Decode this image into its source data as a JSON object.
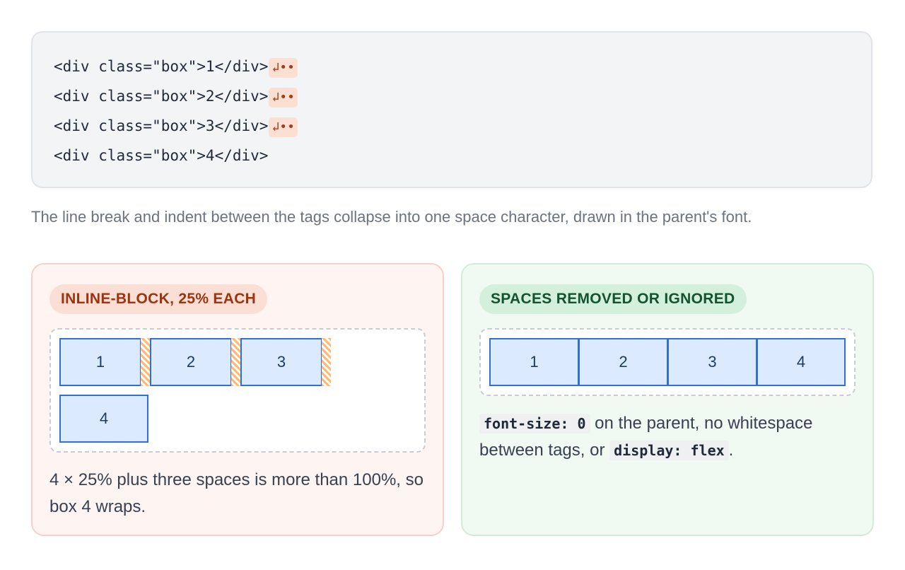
{
  "code": {
    "lines": [
      "<div class=\"box\">1</div>",
      "<div class=\"box\">2</div>",
      "<div class=\"box\">3</div>",
      "<div class=\"box\">4</div>"
    ],
    "whitespace_marker": "↲••"
  },
  "caption": "The line break and indent between the tags collapse into one space character, drawn in the parent's font.",
  "left_panel": {
    "title": "INLINE-BLOCK, 25% EACH",
    "boxes": [
      "1",
      "2",
      "3",
      "4"
    ],
    "text": "4 × 25% plus three spaces is more than 100%, so box 4 wraps."
  },
  "right_panel": {
    "title": "SPACES REMOVED OR IGNORED",
    "boxes": [
      "1",
      "2",
      "3",
      "4"
    ],
    "code_1": "font-size: 0",
    "text_1": " on the parent, no whitespace between tags, or ",
    "code_2": "display: flex",
    "text_2": "."
  },
  "colors": {
    "box_fill": "#dbeafe",
    "box_border": "#2f6fd6",
    "space_marker": "#fdba74",
    "left_accent": "#9a3412",
    "right_accent": "#14532d"
  }
}
